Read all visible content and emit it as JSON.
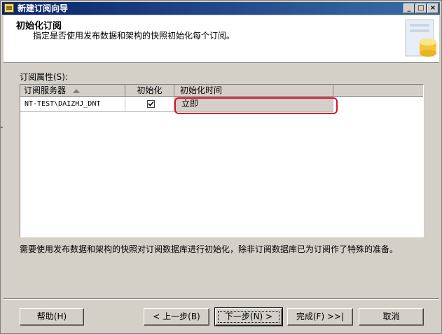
{
  "window": {
    "title": "新建订阅向导",
    "controls": {
      "minimize": "_",
      "maximize": "□",
      "close": "×"
    }
  },
  "header": {
    "title": "初始化订阅",
    "description": "指定是否使用发布数据和架构的快照初始化每个订阅。",
    "graphic_icon": "database-wizard-icon"
  },
  "subscription_properties": {
    "label": "订阅属性(S):",
    "columns": [
      "订阅服务器",
      "初始化",
      "初始化时间"
    ],
    "sort_icon": "sort-ascending-icon",
    "rows": [
      {
        "subscriber": "NT-TEST\\DAIZHJ_DNT",
        "initialize": true,
        "init_time": "立即"
      }
    ]
  },
  "note": "需要使用发布数据和架构的快照对订阅数据库进行初始化，除非订阅数据库已为订阅作了特殊的准备。",
  "buttons": {
    "help": "帮助(H)",
    "back": "< 上一步(B)",
    "next": "下一步(N) >",
    "finish": "完成(F) >>|",
    "cancel": "取消"
  },
  "colors": {
    "highlight": "#e0102a",
    "titlebar": "#0a246a",
    "window": "#d4d0c8"
  }
}
